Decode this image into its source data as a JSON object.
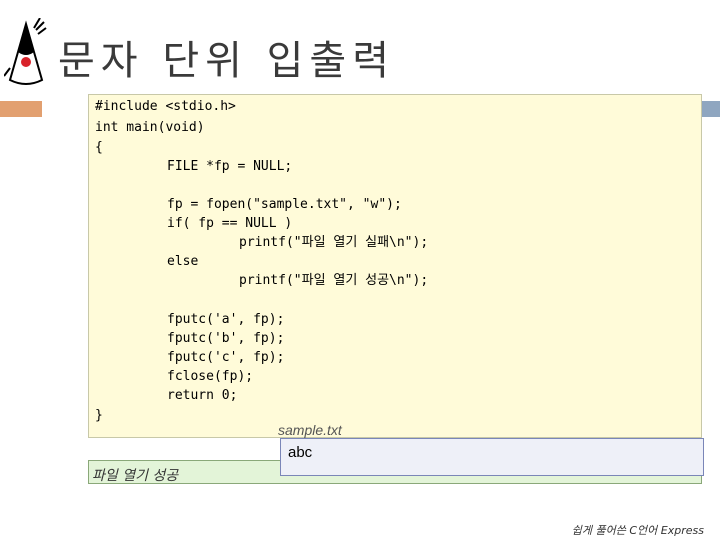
{
  "slide": {
    "title": "문자 단위 입출력",
    "logo": "java-duke-mascot-icon"
  },
  "code": {
    "lines": [
      "#include <stdio.h>",
      "int main(void)",
      "{",
      "FILE *fp = NULL;",
      "fp = fopen(\"sample.txt\", \"w\");",
      "if( fp == NULL )",
      "printf(\"파일 열기 실패\\n\");",
      "else",
      "printf(\"파일 열기 성공\\n\");",
      "fputc('a', fp);",
      "fputc('b', fp);",
      "fputc('c', fp);",
      "fclose(fp);",
      "return 0;",
      "}"
    ]
  },
  "file": {
    "name": "sample.txt",
    "content": "abc"
  },
  "console": {
    "output": "파일 열기 성공"
  },
  "footer": {
    "text": "쉽게 풀어쓴 C언어 Express"
  },
  "colors": {
    "code_bg": "#fffbd9",
    "output_bg": "#e3f4d8",
    "accent_orange": "#e2a070",
    "accent_blue": "#8fa6c0"
  }
}
